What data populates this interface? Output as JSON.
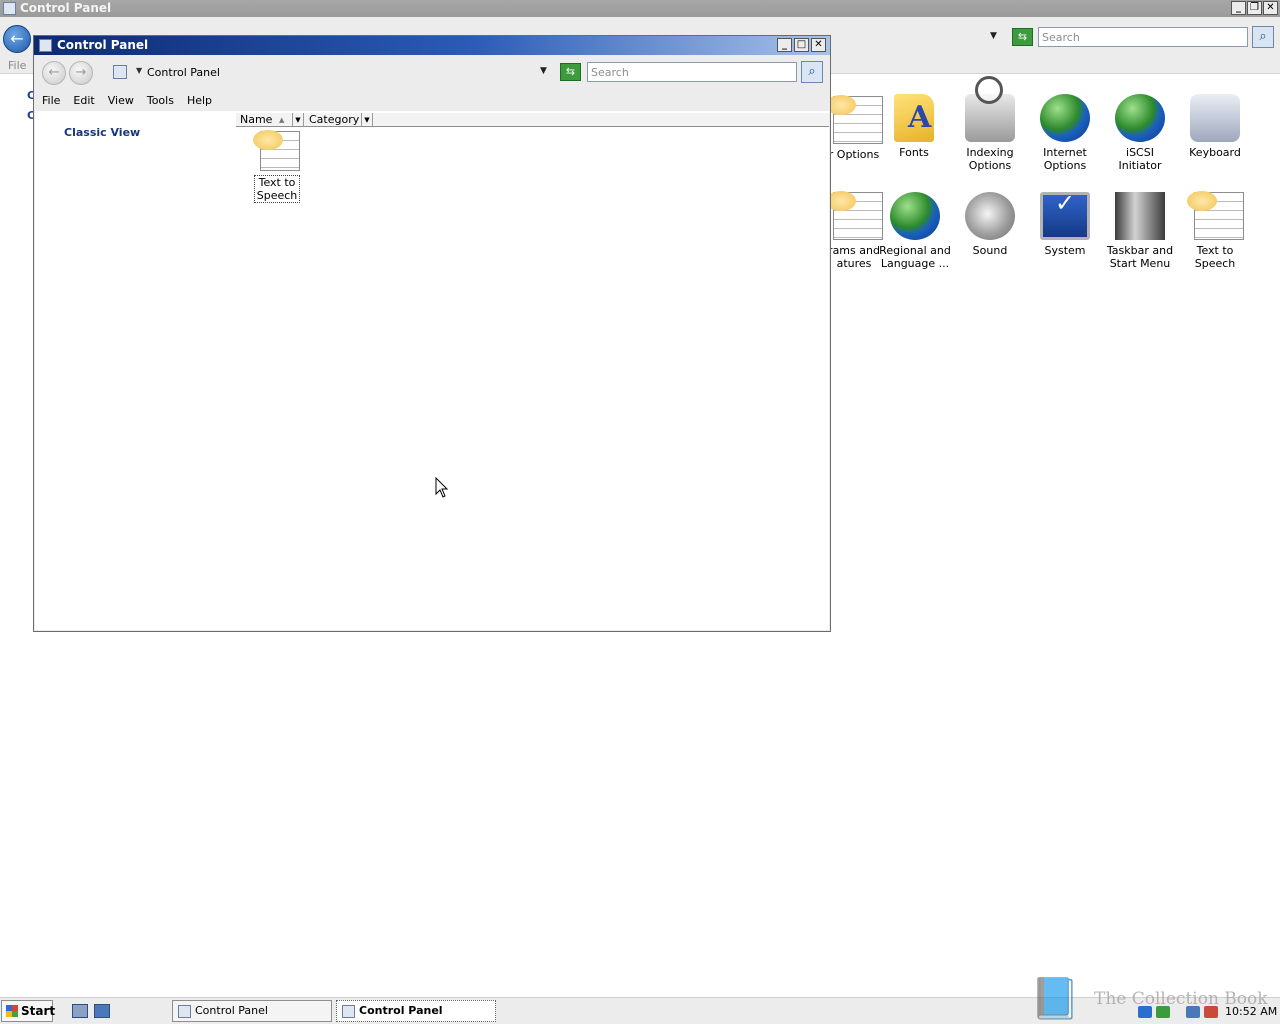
{
  "background_window": {
    "title": "Control Panel",
    "search_placeholder": "Search",
    "menu_file": "File",
    "left_fragments": [
      "C",
      "C"
    ],
    "icons": [
      {
        "label": "r Options",
        "icon": "folder-options-icon"
      },
      {
        "label": "Fonts",
        "icon": "fonts-folder-icon"
      },
      {
        "label": "Indexing Options",
        "icon": "indexing-options-icon"
      },
      {
        "label": "Internet Options",
        "icon": "internet-options-icon"
      },
      {
        "label": "iSCSI Initiator",
        "icon": "iscsi-initiator-icon"
      },
      {
        "label": "Keyboard",
        "icon": "keyboard-icon"
      },
      {
        "label": "rams and atures",
        "icon": "programs-and-features-icon"
      },
      {
        "label": "Regional and Language ...",
        "icon": "regional-language-icon"
      },
      {
        "label": "Sound",
        "icon": "sound-icon"
      },
      {
        "label": "System",
        "icon": "system-icon"
      },
      {
        "label": "Taskbar and Start Menu",
        "icon": "taskbar-start-menu-icon"
      },
      {
        "label": "Text to Speech",
        "icon": "text-to-speech-icon"
      }
    ]
  },
  "window": {
    "title": "Control Panel",
    "address": "Control Panel",
    "search_placeholder": "Search",
    "menu": [
      "File",
      "Edit",
      "View",
      "Tools",
      "Help"
    ],
    "sidebar_link": "Classic View",
    "columns": [
      "Name",
      "Category"
    ],
    "items": [
      {
        "label": "Text to Speech",
        "icon": "text-to-speech-icon"
      }
    ]
  },
  "taskbar": {
    "start_label": "Start",
    "tasks": [
      "Control Panel",
      "Control Panel"
    ],
    "clock": "10:52 AM"
  },
  "watermark": "The Collection Book",
  "colors": {
    "title_active": "#0c2a72",
    "title_inactive": "#9a9a9a",
    "link": "#17357e"
  }
}
